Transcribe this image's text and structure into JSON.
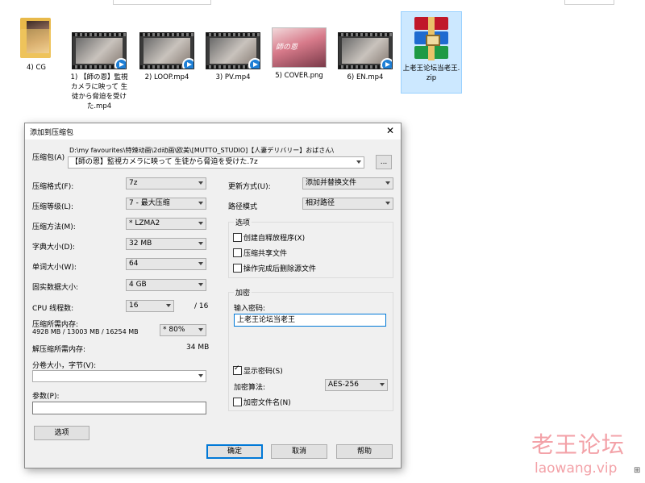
{
  "files": [
    {
      "name": "4) CG",
      "type": "folder"
    },
    {
      "name": "1) 【師の恩】監視カメラに映って 生徒から脅迫を受けた.mp4",
      "type": "video"
    },
    {
      "name": "2) LOOP.mp4",
      "type": "video"
    },
    {
      "name": "3) PV.mp4",
      "type": "video"
    },
    {
      "name": "5) COVER.png",
      "type": "image"
    },
    {
      "name": "6) EN.mp4",
      "type": "video"
    },
    {
      "name": "上老王论坛当老王.zip",
      "type": "zip"
    }
  ],
  "cover_thumb_text": "師の恩",
  "dialog": {
    "title": "添加到压缩包",
    "close": "✕",
    "archive_label": "压缩包(A)",
    "archive_path": "D:\\my favourites\\特辣动画\\2d动画\\欧美\\[MUTTO_STUDIO]【人妻デリバリー】おばさん\\",
    "archive_name": "【師の恩】監視カメラに映って 生徒から脅迫を受けた.7z",
    "browse": "...",
    "format_label": "压缩格式(F):",
    "format_value": "7z",
    "level_label": "压缩等级(L):",
    "level_value": "7 - 最大压缩",
    "method_label": "压缩方法(M):",
    "method_value": "* LZMA2",
    "dict_label": "字典大小(D):",
    "dict_value": "32 MB",
    "word_label": "单词大小(W):",
    "word_value": "64",
    "solid_label": "固实数据大小:",
    "solid_value": "4 GB",
    "cpu_label": "CPU 线程数:",
    "cpu_value": "16",
    "cpu_total": "/ 16",
    "mem_label": "压缩所需内存:",
    "mem_values": "4928 MB / 13003 MB / 16254 MB",
    "mem_percent": "* 80%",
    "decomp_label": "解压缩所需内存:",
    "decomp_value": "34 MB",
    "split_label": "分卷大小，字节(V):",
    "split_value": "",
    "params_label": "参数(P):",
    "params_value": "",
    "options_button": "选项",
    "update_label": "更新方式(U):",
    "update_value": "添加并替换文件",
    "path_label": "路径模式",
    "path_value": "相对路径",
    "options_group": "选项",
    "opt_sfx": "创建自释放程序(X)",
    "opt_shared": "压缩共享文件",
    "opt_delete": "操作完成后删除源文件",
    "encrypt_group": "加密",
    "password_label": "输入密码:",
    "password_value": "上老王论坛当老王",
    "show_password": "显示密码(S)",
    "enc_method_label": "加密算法:",
    "enc_method_value": "AES-256",
    "encrypt_names": "加密文件名(N)",
    "ok": "确定",
    "cancel": "取消",
    "help": "帮助"
  },
  "watermark": {
    "line1": "老王论坛",
    "line2": "laowang.vip"
  },
  "corner_text": "⊞"
}
